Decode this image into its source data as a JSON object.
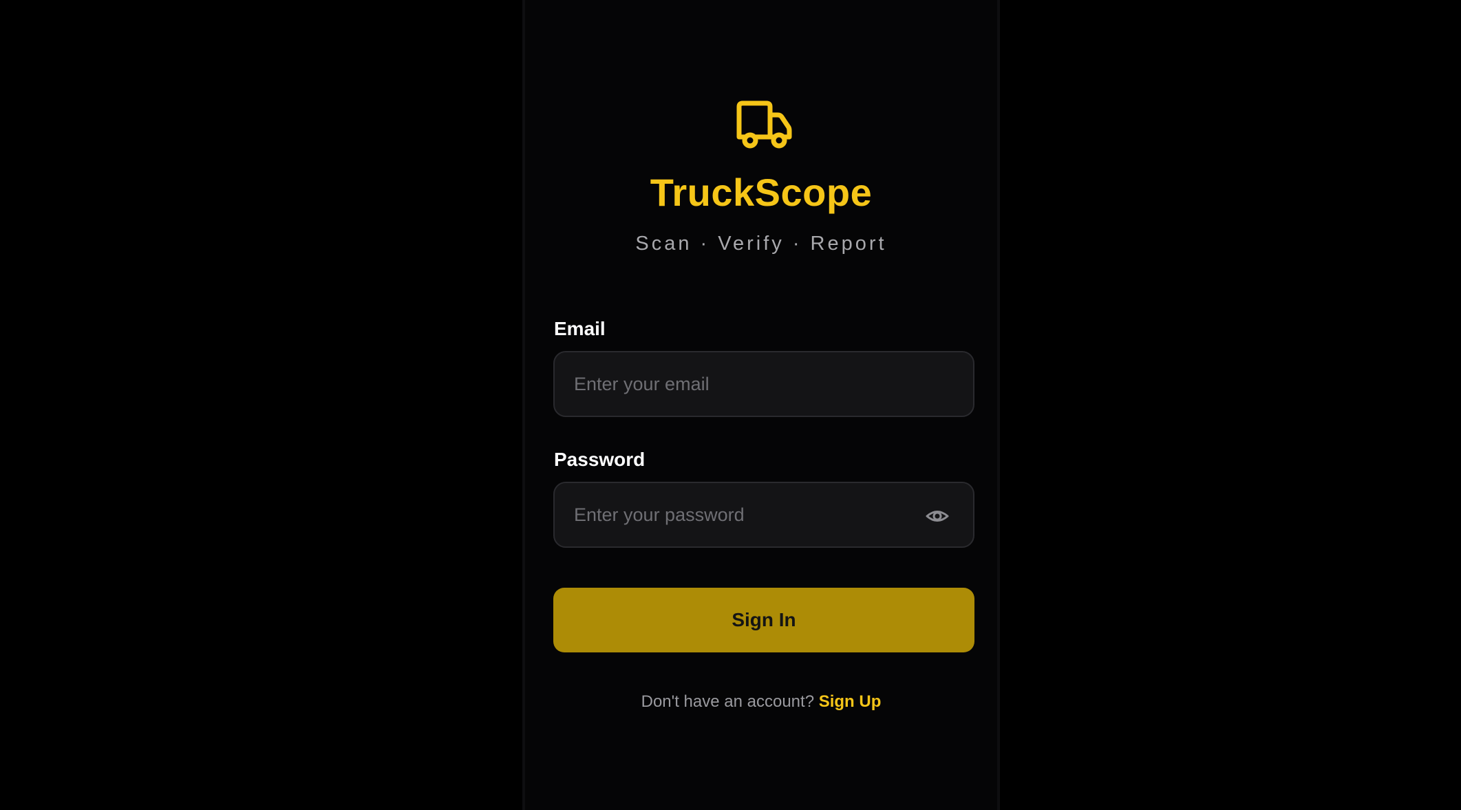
{
  "app": {
    "title": "TruckScope",
    "tagline": "Scan · Verify · Report",
    "logo_icon": "truck-icon",
    "accent_color": "#f5c518"
  },
  "form": {
    "email": {
      "label": "Email",
      "placeholder": "Enter your email",
      "value": ""
    },
    "password": {
      "label": "Password",
      "placeholder": "Enter your password",
      "value": "",
      "toggle_icon": "eye-icon"
    },
    "submit_label": "Sign In",
    "submit_color": "#ad8c06"
  },
  "footer": {
    "prompt": "Don't have an account?",
    "link_label": "Sign Up"
  }
}
